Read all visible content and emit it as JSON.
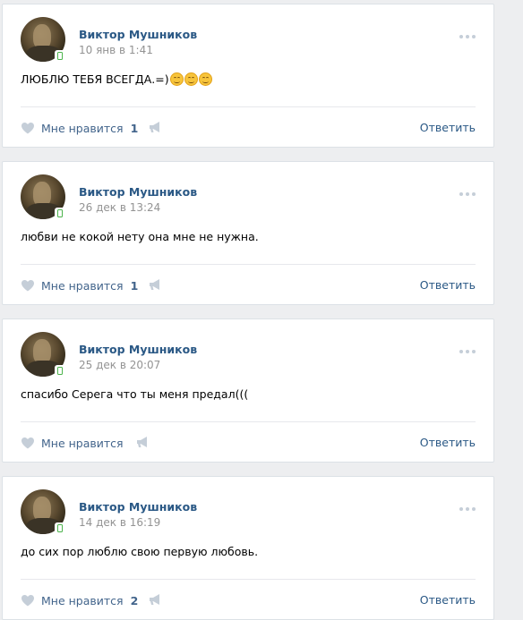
{
  "posts": [
    {
      "author": "Виктор Мушников",
      "date": "10 янв в 1:41",
      "text": "ЛЮБЛЮ ТЕБЯ ВСЕГДА.=)",
      "emoji_count": 3,
      "like_label": "Мне нравится",
      "like_count": "1",
      "reply_label": "Ответить"
    },
    {
      "author": "Виктор Мушников",
      "date": "26 дек в 13:24",
      "text": "любви не кокой нету она мне не нужна.",
      "emoji_count": 0,
      "like_label": "Мне нравится",
      "like_count": "1",
      "reply_label": "Ответить"
    },
    {
      "author": "Виктор Мушников",
      "date": "25 дек в 20:07",
      "text": "спасибо Серега что ты меня предал(((",
      "emoji_count": 0,
      "like_label": "Мне нравится",
      "like_count": "",
      "reply_label": "Ответить"
    },
    {
      "author": "Виктор Мушников",
      "date": "14 дек в 16:19",
      "text": "до сих пор люблю свою первую любовь.",
      "emoji_count": 0,
      "like_label": "Мне нравится",
      "like_count": "2",
      "reply_label": "Ответить"
    }
  ],
  "icons": {
    "avatar": "user-avatar",
    "mobile": "mobile-phone-icon",
    "more": "more-dots-icon",
    "like": "heart-icon",
    "share": "megaphone-icon",
    "emoji": "smiling-face-emoji"
  },
  "colors": {
    "background": "#edeef0",
    "card": "#ffffff",
    "link": "#2a5885",
    "secondary": "#939393",
    "action": "#42648b",
    "icon": "#c5ced8",
    "online_mobile": "#4bb34b"
  }
}
